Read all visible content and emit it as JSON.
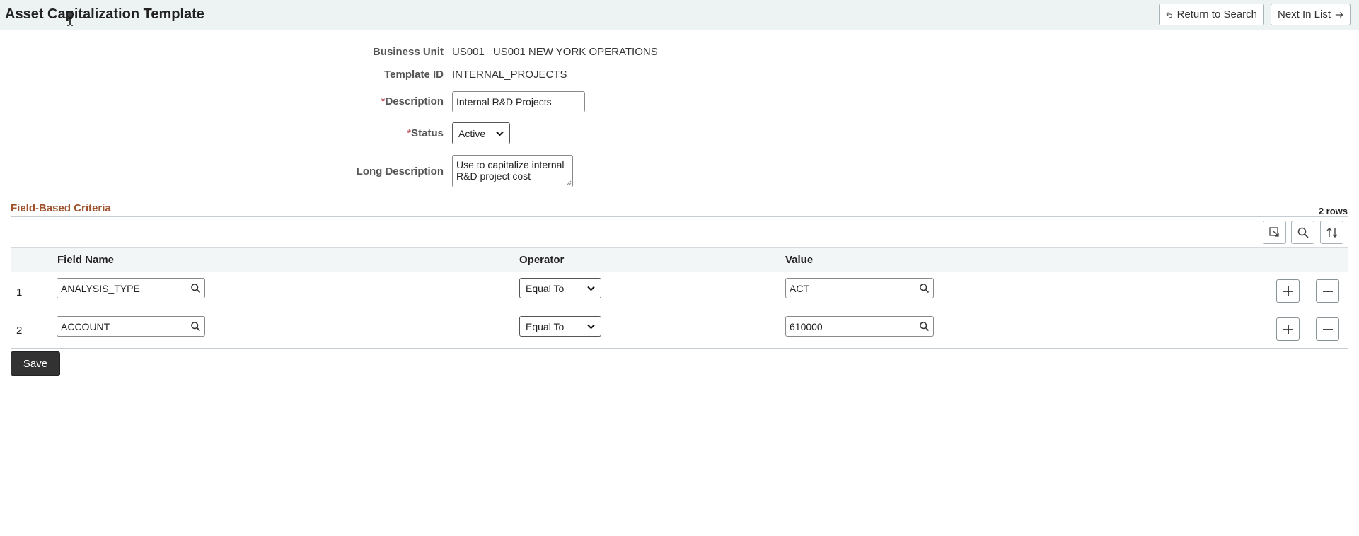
{
  "header": {
    "title": "Asset Capitalization Template",
    "return_label": "Return to Search",
    "next_label": "Next In List"
  },
  "form": {
    "business_unit_label": "Business Unit",
    "business_unit_code": "US001",
    "business_unit_name": "US001 NEW YORK OPERATIONS",
    "template_id_label": "Template ID",
    "template_id_value": "INTERNAL_PROJECTS",
    "required_mark": "*",
    "description_label": "Description",
    "description_value": "Internal R&D Projects",
    "status_label": "Status",
    "status_value": "Active",
    "long_description_label": "Long Description",
    "long_description_line1": "Use to capitalize internal",
    "long_description_line2": "R&D project cost"
  },
  "grid": {
    "title": "Field-Based Criteria",
    "row_count": "2 rows",
    "columns": {
      "field_name": "Field Name",
      "operator": "Operator",
      "value": "Value"
    },
    "rows": [
      {
        "num": "1",
        "field_name": "ANALYSIS_TYPE",
        "operator": "Equal To",
        "value": "ACT"
      },
      {
        "num": "2",
        "field_name": "ACCOUNT",
        "operator": "Equal To",
        "value": "610000"
      }
    ]
  },
  "save_label": "Save",
  "colors": {
    "header_bg": "#edf3f3",
    "section_title": "#a0522d",
    "save_bg": "#333232",
    "required": "#b3444b"
  }
}
